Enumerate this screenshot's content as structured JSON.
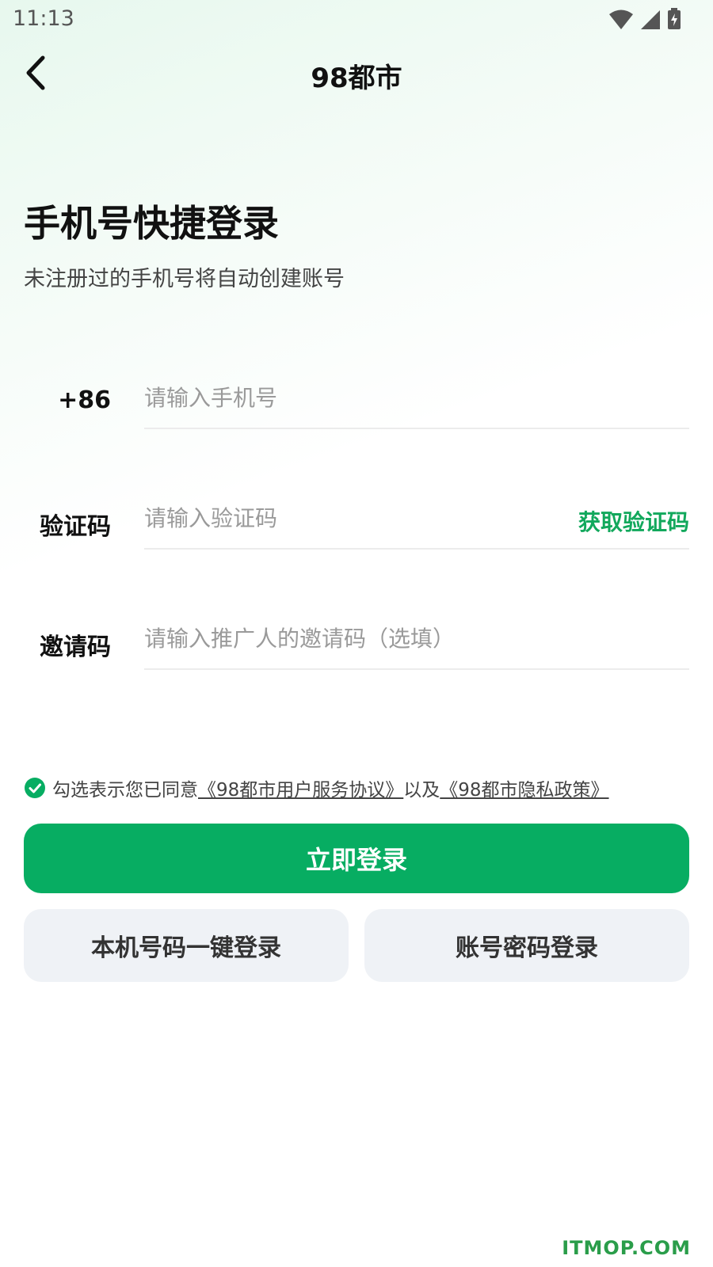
{
  "status_bar": {
    "time": "11:13"
  },
  "nav": {
    "title": "98都市",
    "back_icon": "chevron-left-icon"
  },
  "heading": {
    "title": "手机号快捷登录",
    "subtitle": "未注册过的手机号将自动创建账号"
  },
  "form": {
    "phone": {
      "label": "+86",
      "placeholder": "请输入手机号",
      "value": ""
    },
    "code": {
      "label": "验证码",
      "placeholder": "请输入验证码",
      "value": "",
      "get_code_label": "获取验证码"
    },
    "invite": {
      "label": "邀请码",
      "placeholder": "请输入推广人的邀请码（选填）",
      "value": ""
    }
  },
  "agreement": {
    "checked": true,
    "prefix": "勾选表示您已同意",
    "service_link": "《98都市用户服务协议》",
    "connector": "以及",
    "privacy_link": "《98都市隐私政策》"
  },
  "buttons": {
    "login": "立即登录",
    "one_click": "本机号码一键登录",
    "password": "账号密码登录"
  },
  "watermark": "ITMOP.COM",
  "colors": {
    "accent": "#07ad62",
    "link_green": "#12a85c",
    "secondary_button": "#eff2f6"
  }
}
